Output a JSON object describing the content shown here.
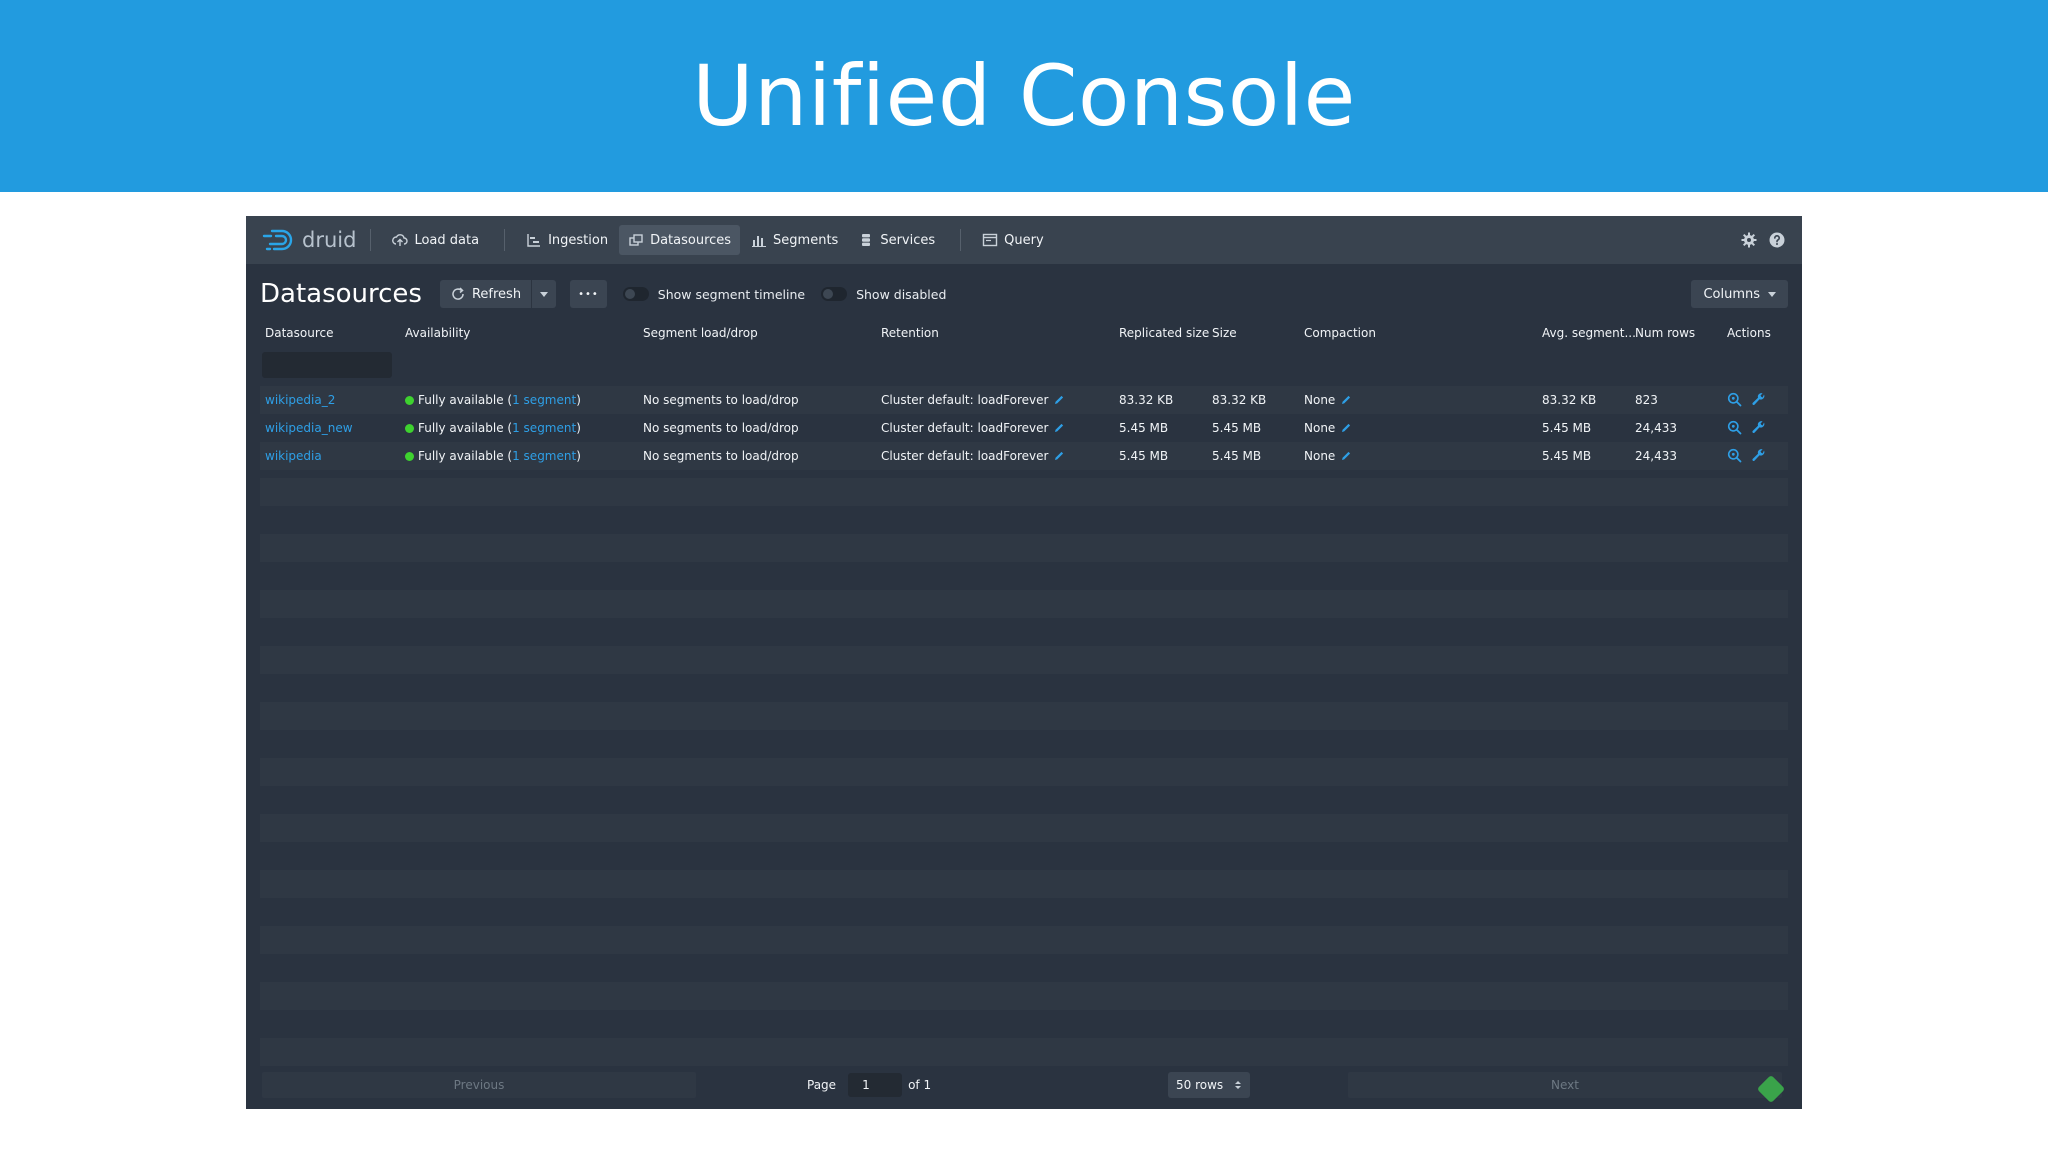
{
  "banner": {
    "title": "Unified Console"
  },
  "navbar": {
    "logo_text": "druid",
    "items": [
      {
        "label": "Load data",
        "icon": "cloud-upload-icon",
        "active": false
      },
      {
        "label": "Ingestion",
        "icon": "gantt-chart-icon",
        "active": false
      },
      {
        "label": "Datasources",
        "icon": "datasources-icon",
        "active": true
      },
      {
        "label": "Segments",
        "icon": "stacked-chart-icon",
        "active": false
      },
      {
        "label": "Services",
        "icon": "database-icon",
        "active": false
      },
      {
        "label": "Query",
        "icon": "application-icon",
        "active": false
      }
    ],
    "right_icons": [
      "gear-icon",
      "help-icon"
    ]
  },
  "controls": {
    "page_title": "Datasources",
    "refresh_label": "Refresh",
    "more_label": "•••",
    "toggle_timeline_label": "Show segment timeline",
    "toggle_disabled_label": "Show disabled",
    "columns_label": "Columns"
  },
  "table": {
    "headers": [
      "Datasource",
      "Availability",
      "Segment load/drop",
      "Retention",
      "Replicated size",
      "Size",
      "Compaction",
      "Avg. segment...",
      "Num rows",
      "Actions"
    ],
    "rows": [
      {
        "datasource": "wikipedia_2",
        "availability_prefix": "Fully available (",
        "availability_link": "1 segment",
        "availability_suffix": ")",
        "load_drop": "No segments to load/drop",
        "retention": "Cluster default: loadForever",
        "replicated_size": "83.32 KB",
        "size": "83.32 KB",
        "compaction": "None",
        "avg_segment": "83.32 KB",
        "num_rows": "823"
      },
      {
        "datasource": "wikipedia_new",
        "availability_prefix": "Fully available (",
        "availability_link": "1 segment",
        "availability_suffix": ")",
        "load_drop": "No segments to load/drop",
        "retention": "Cluster default: loadForever",
        "replicated_size": "5.45 MB",
        "size": "5.45 MB",
        "compaction": "None",
        "avg_segment": "5.45 MB",
        "num_rows": "24,433"
      },
      {
        "datasource": "wikipedia",
        "availability_prefix": "Fully available (",
        "availability_link": "1 segment",
        "availability_suffix": ")",
        "load_drop": "No segments to load/drop",
        "retention": "Cluster default: loadForever",
        "replicated_size": "5.45 MB",
        "size": "5.45 MB",
        "compaction": "None",
        "avg_segment": "5.45 MB",
        "num_rows": "24,433"
      }
    ]
  },
  "pagination": {
    "previous_label": "Previous",
    "page_label": "Page",
    "page_value": "1",
    "of_label": "of 1",
    "rows_label": "50 rows",
    "next_label": "Next"
  },
  "colors": {
    "banner": "#229bdf",
    "console_bg": "#2a3340",
    "navbar_bg": "#39434f",
    "link": "#2e9fe6",
    "status_green": "#3ed22f"
  }
}
